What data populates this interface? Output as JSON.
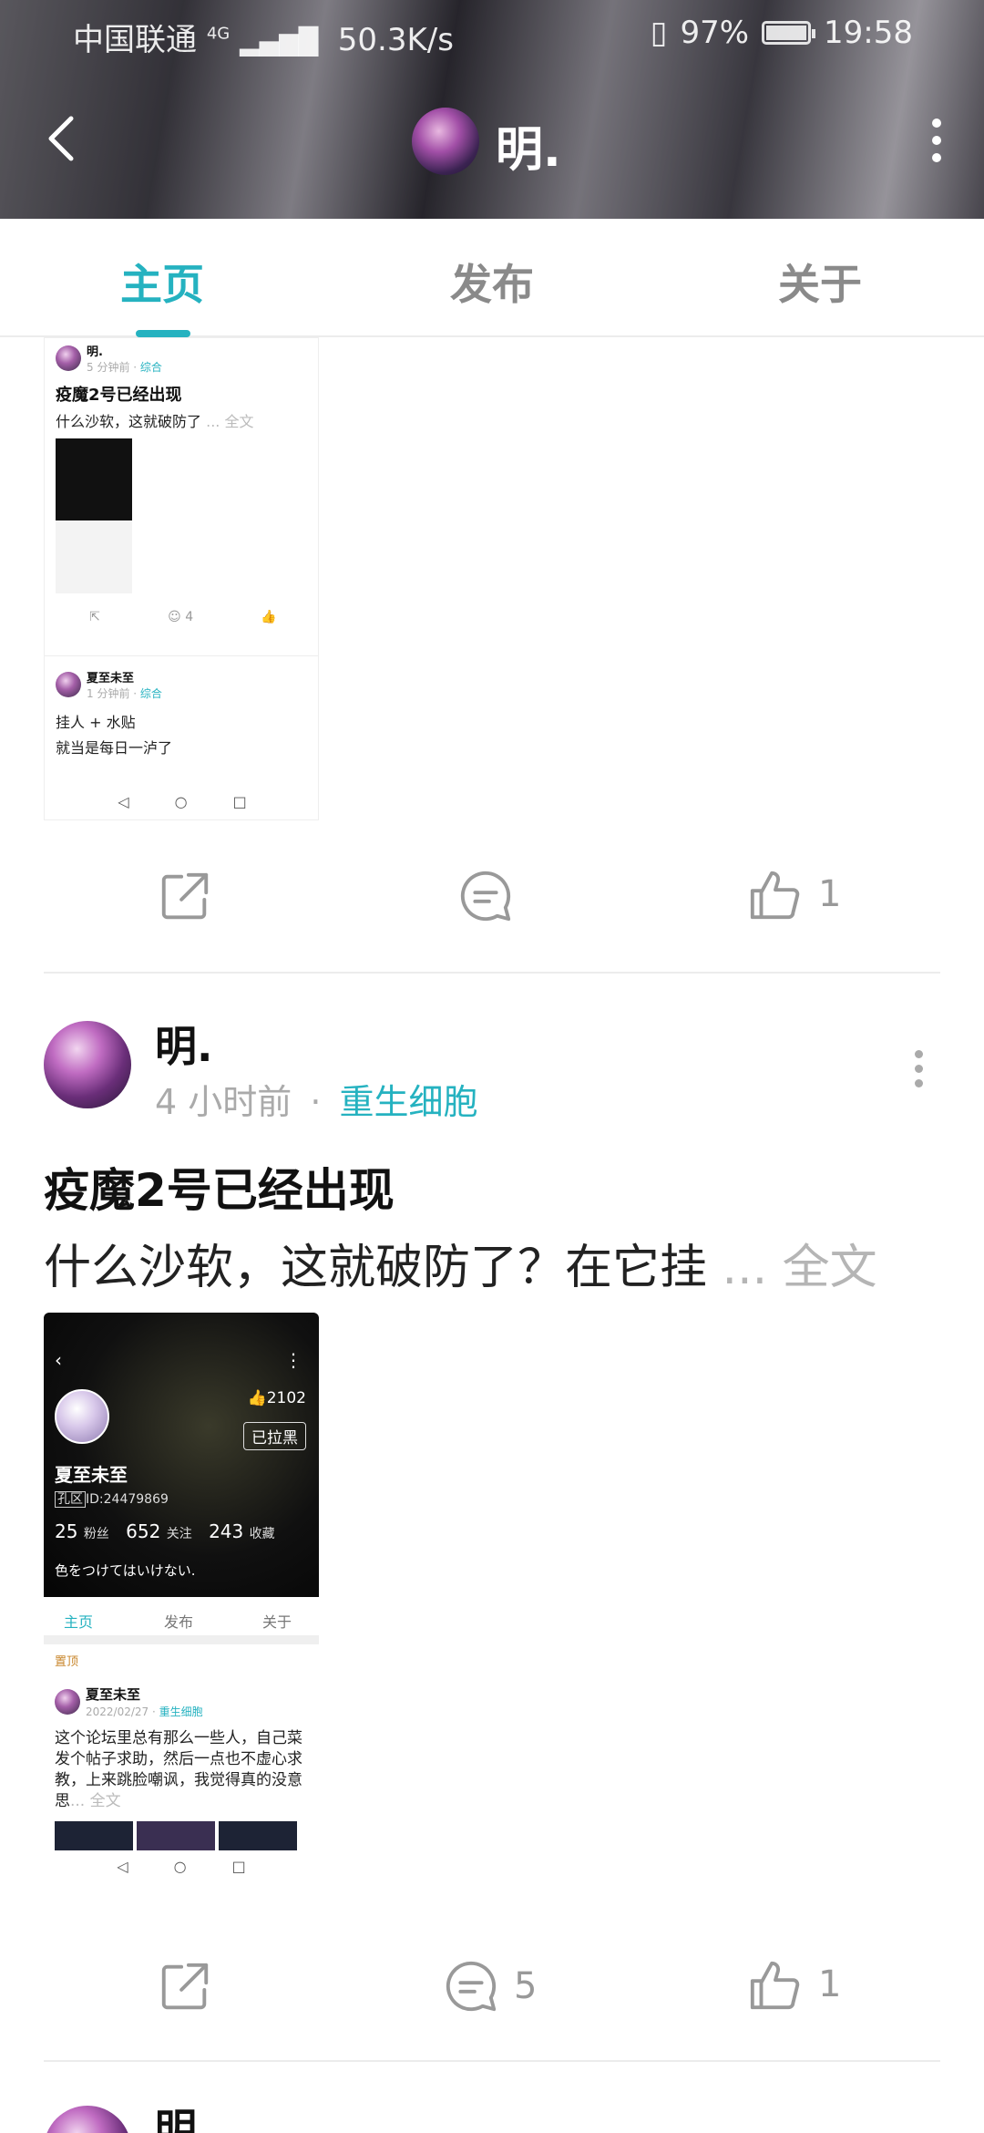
{
  "status_bar": {
    "carrier": "中国联通",
    "network": "4G",
    "speed": "50.3K/s",
    "battery": "97%",
    "time": "19:58"
  },
  "header": {
    "user_name": "明."
  },
  "tabs": [
    {
      "label": "主页",
      "active": true
    },
    {
      "label": "发布",
      "active": false
    },
    {
      "label": "关于",
      "active": false
    }
  ],
  "posts": [
    {
      "screenshot": {
        "author": "明.",
        "time": "5 分钟前",
        "category": "综合",
        "title": "疫魔2号已经出现",
        "text": "什么沙软，这就破防了",
        "full": "... 全文",
        "comment_count": "4",
        "second_author": "夏至未至",
        "second_time": "1 分钟前",
        "second_category": "综合",
        "second_text_1": "挂人 + 水贴",
        "second_text_2": "就当是每日一泸了"
      },
      "comment_count": "",
      "like_count": "1"
    },
    {
      "author": "明.",
      "time": "4 小时前",
      "dot": "·",
      "category": "重生细胞",
      "title": "疫魔2号已经出现",
      "text": "什么沙软，这就破防了？在它挂",
      "full": "... 全文",
      "screenshot": {
        "likes": "2102",
        "block_label": "已拉黑",
        "name": "夏至未至",
        "id": "ID:24479869",
        "id_prefix": "孔区",
        "fans": "25",
        "fans_label": "粉丝",
        "following": "652",
        "following_label": "关注",
        "favorites": "243",
        "favorites_label": "收藏",
        "signature": "色をつけてはいけない.",
        "tabs": [
          "主页",
          "发布",
          "关于"
        ],
        "pinned": "置顶",
        "post_author": "夏至未至",
        "post_time": "2022/02/27",
        "post_category": "重生细胞",
        "post_text": "这个论坛里总有那么一些人，自己菜发个帖子求助，然后一点也不虚心求教，上来跳脸嘲讽，我觉得真的没意思",
        "post_full": "... 全文"
      },
      "comment_count": "5",
      "like_count": "1"
    },
    {
      "author": "明"
    }
  ]
}
